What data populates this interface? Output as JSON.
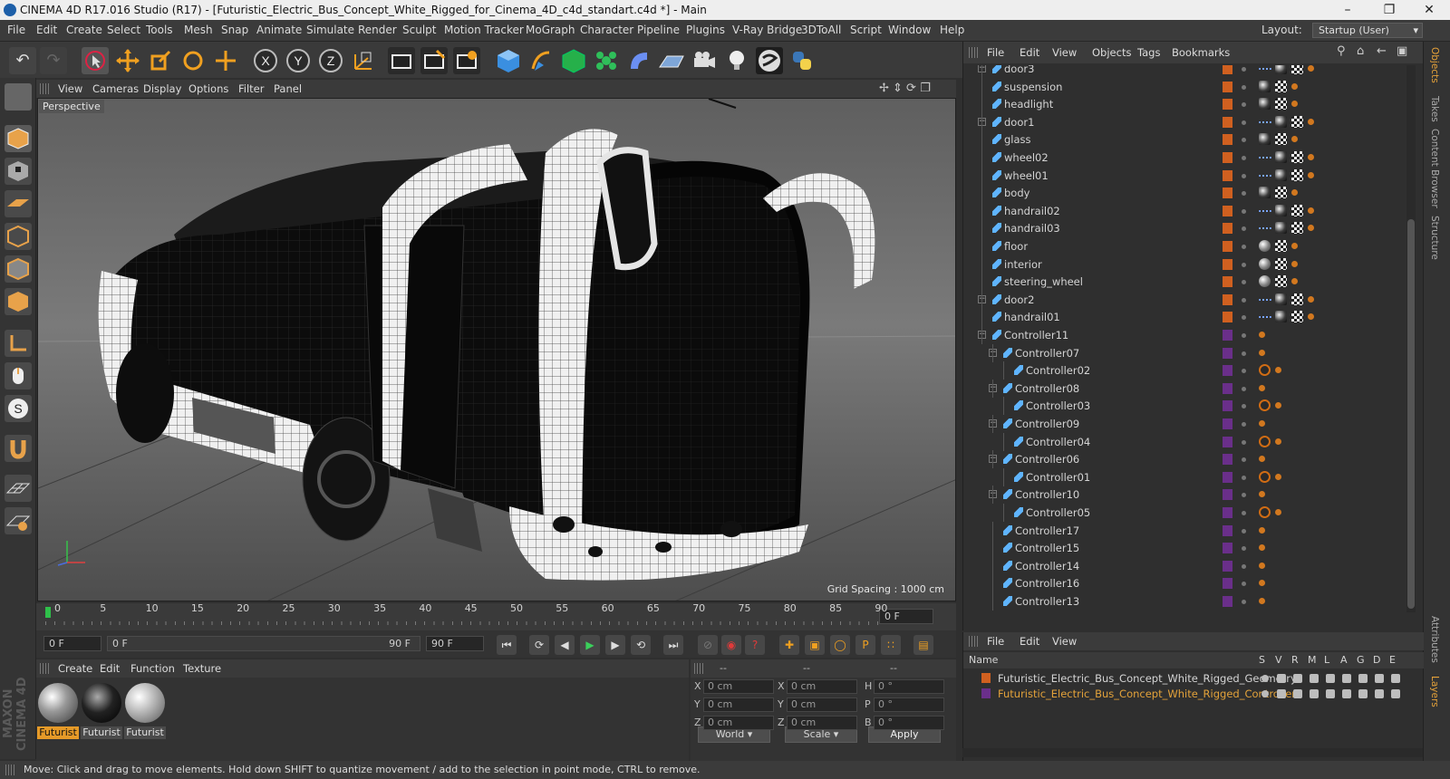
{
  "window": {
    "title": "CINEMA 4D R17.016 Studio (R17) - [Futuristic_Electric_Bus_Concept_White_Rigged_for_Cinema_4D_c4d_standart.c4d *] - Main"
  },
  "menubar": {
    "items": [
      "File",
      "Edit",
      "Create",
      "Select",
      "Tools",
      "Mesh",
      "Snap",
      "Animate",
      "Simulate",
      "Render",
      "Sculpt",
      "Motion Tracker",
      "MoGraph",
      "Character",
      "Pipeline",
      "Plugins",
      "V-Ray Bridge",
      "3DToAll",
      "Script",
      "Window",
      "Help"
    ],
    "layout_label": "Layout:",
    "layout_value": "Startup (User)"
  },
  "viewport": {
    "menu": [
      "View",
      "Cameras",
      "Display",
      "Options",
      "Filter",
      "Panel"
    ],
    "label": "Perspective",
    "grid_spacing": "Grid Spacing : 1000 cm"
  },
  "timeline": {
    "ticks": [
      "0",
      "5",
      "10",
      "15",
      "20",
      "25",
      "30",
      "35",
      "40",
      "45",
      "50",
      "55",
      "60",
      "65",
      "70",
      "75",
      "80",
      "85",
      "90"
    ],
    "frame_field": "0 F"
  },
  "transport": {
    "start": "0 F",
    "range_left": "0 F",
    "range_right": "90 F",
    "end": "90 F"
  },
  "materials": {
    "menu": [
      "Create",
      "Edit",
      "Function",
      "Texture"
    ],
    "items": [
      {
        "label": "Futurist",
        "selected": true
      },
      {
        "label": "Futurist"
      },
      {
        "label": "Futurist"
      }
    ],
    "logo": "MAXON CINEMA 4D"
  },
  "coordinates": {
    "headers": [
      "--",
      "--",
      "--"
    ],
    "rows": [
      {
        "a": "X",
        "av": "0 cm",
        "b": "X",
        "bv": "0 cm",
        "c": "H",
        "cv": "0 °"
      },
      {
        "a": "Y",
        "av": "0 cm",
        "b": "Y",
        "bv": "0 cm",
        "c": "P",
        "cv": "0 °"
      },
      {
        "a": "Z",
        "av": "0 cm",
        "b": "Z",
        "bv": "0 cm",
        "c": "B",
        "cv": "0 °"
      }
    ],
    "world": "World",
    "scale": "Scale",
    "apply": "Apply"
  },
  "objects": {
    "menu": [
      "File",
      "Edit",
      "View",
      "Objects",
      "Tags",
      "Bookmarks"
    ],
    "rows": [
      {
        "name": "door3",
        "indent": 1,
        "expand": true,
        "color": "#d06020",
        "tags": [
          "dash",
          "shade",
          "check",
          "org"
        ]
      },
      {
        "name": "suspension",
        "indent": 1,
        "color": "#d06020",
        "tags": [
          "shade",
          "check",
          "org"
        ]
      },
      {
        "name": "headlight",
        "indent": 1,
        "color": "#d06020",
        "tags": [
          "shade",
          "check",
          "org"
        ]
      },
      {
        "name": "door1",
        "indent": 1,
        "expand": true,
        "color": "#d06020",
        "tags": [
          "dash",
          "shade",
          "check",
          "org"
        ]
      },
      {
        "name": "glass",
        "indent": 1,
        "color": "#d06020",
        "tags": [
          "shade",
          "check",
          "org"
        ]
      },
      {
        "name": "wheel02",
        "indent": 1,
        "color": "#d06020",
        "tags": [
          "dash",
          "shade",
          "check",
          "org"
        ]
      },
      {
        "name": "wheel01",
        "indent": 1,
        "color": "#d06020",
        "tags": [
          "dash",
          "shade",
          "check",
          "org"
        ]
      },
      {
        "name": "body",
        "indent": 1,
        "color": "#d06020",
        "tags": [
          "shade",
          "check",
          "org"
        ]
      },
      {
        "name": "handrail02",
        "indent": 1,
        "color": "#d06020",
        "tags": [
          "dash",
          "shade",
          "check",
          "org"
        ]
      },
      {
        "name": "handrail03",
        "indent": 1,
        "color": "#d06020",
        "tags": [
          "dash",
          "shade",
          "check",
          "org"
        ]
      },
      {
        "name": "floor",
        "indent": 1,
        "color": "#d06020",
        "tags": [
          "sphere",
          "check",
          "org"
        ]
      },
      {
        "name": "interior",
        "indent": 1,
        "color": "#d06020",
        "tags": [
          "sphere",
          "check",
          "org"
        ]
      },
      {
        "name": "steering_wheel",
        "indent": 1,
        "color": "#d06020",
        "tags": [
          "sphere",
          "check",
          "org"
        ]
      },
      {
        "name": "door2",
        "indent": 1,
        "expand": true,
        "color": "#d06020",
        "tags": [
          "dash",
          "shade",
          "check",
          "org"
        ]
      },
      {
        "name": "handrail01",
        "indent": 1,
        "color": "#d06020",
        "tags": [
          "dash",
          "shade",
          "check",
          "org"
        ]
      },
      {
        "name": "Controller11",
        "indent": 1,
        "expand": true,
        "color": "#6a2f8a",
        "tags": [
          "org"
        ]
      },
      {
        "name": "Controller07",
        "indent": 2,
        "expand": true,
        "color": "#6a2f8a",
        "tags": [
          "org"
        ]
      },
      {
        "name": "Controller02",
        "indent": 3,
        "color": "#6a2f8a",
        "tags": [
          "ban",
          "org"
        ]
      },
      {
        "name": "Controller08",
        "indent": 2,
        "expand": true,
        "color": "#6a2f8a",
        "tags": [
          "org"
        ]
      },
      {
        "name": "Controller03",
        "indent": 3,
        "color": "#6a2f8a",
        "tags": [
          "ban",
          "org"
        ]
      },
      {
        "name": "Controller09",
        "indent": 2,
        "expand": true,
        "color": "#6a2f8a",
        "tags": [
          "org"
        ]
      },
      {
        "name": "Controller04",
        "indent": 3,
        "color": "#6a2f8a",
        "tags": [
          "ban",
          "org"
        ]
      },
      {
        "name": "Controller06",
        "indent": 2,
        "expand": true,
        "color": "#6a2f8a",
        "tags": [
          "org"
        ]
      },
      {
        "name": "Controller01",
        "indent": 3,
        "color": "#6a2f8a",
        "tags": [
          "ban",
          "org"
        ]
      },
      {
        "name": "Controller10",
        "indent": 2,
        "expand": true,
        "color": "#6a2f8a",
        "tags": [
          "org"
        ]
      },
      {
        "name": "Controller05",
        "indent": 3,
        "color": "#6a2f8a",
        "tags": [
          "ban",
          "org"
        ]
      },
      {
        "name": "Controller17",
        "indent": 2,
        "color": "#6a2f8a",
        "tags": [
          "org"
        ]
      },
      {
        "name": "Controller15",
        "indent": 2,
        "color": "#6a2f8a",
        "tags": [
          "org"
        ]
      },
      {
        "name": "Controller14",
        "indent": 2,
        "color": "#6a2f8a",
        "tags": [
          "org"
        ]
      },
      {
        "name": "Controller16",
        "indent": 2,
        "color": "#6a2f8a",
        "tags": [
          "org"
        ]
      },
      {
        "name": "Controller13",
        "indent": 2,
        "color": "#6a2f8a",
        "tags": [
          "org"
        ]
      }
    ]
  },
  "side_tabs": [
    "Objects",
    "Takes",
    "Content Browser",
    "Structure",
    "Attributes",
    "Layers"
  ],
  "layers": {
    "menu": [
      "File",
      "Edit",
      "View"
    ],
    "header_name": "Name",
    "header_cols": [
      "S",
      "V",
      "R",
      "M",
      "L",
      "A",
      "G",
      "D",
      "E"
    ],
    "rows": [
      {
        "name": "Futuristic_Electric_Bus_Concept_White_Rigged_Geometry",
        "color": "#d06020",
        "text_color": "#d4d4d4"
      },
      {
        "name": "Futuristic_Electric_Bus_Concept_White_Rigged_Controllers",
        "color": "#6a2f8a",
        "text_color": "#e3a23a"
      }
    ]
  },
  "status": "Move: Click and drag to move elements. Hold down SHIFT to quantize movement / add to the selection in point mode, CTRL to remove."
}
